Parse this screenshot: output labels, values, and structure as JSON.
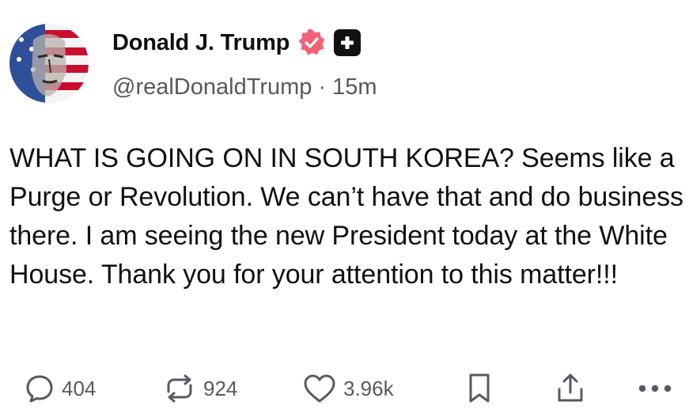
{
  "author": {
    "display_name": "Donald J. Trump",
    "handle": "@realDonaldTrump",
    "separator": "·",
    "time_ago": "15m"
  },
  "post": {
    "text": "WHAT IS GOING ON IN SOUTH KOREA? Seems like a Purge or Revolution. We can’t have that and do business there. I am seeing the new President today at the White House. Thank you for your attention to this matter!!!"
  },
  "actions": {
    "reply_count": "404",
    "repost_count": "924",
    "like_count": "3.96k"
  },
  "icons": {
    "verified": "verified-badge-icon",
    "plus": "plus-badge-icon",
    "reply": "speech-bubble-icon",
    "repost": "repost-arrows-icon",
    "like": "heart-icon",
    "bookmark": "bookmark-icon",
    "share": "share-upload-icon",
    "more": "more-dots-icon"
  },
  "colors": {
    "verified_badge": "#f06277",
    "muted_text": "#555a60",
    "text": "#111111"
  }
}
